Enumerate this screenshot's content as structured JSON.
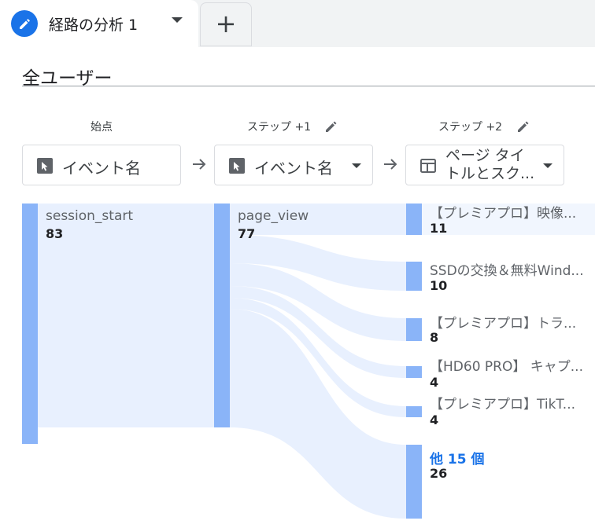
{
  "tab": {
    "title": "経路の分析 1",
    "add_label": "+"
  },
  "segment": {
    "title": "全ユーザー"
  },
  "columns": {
    "start": {
      "label": "始点",
      "dimension": "イベント名"
    },
    "step1": {
      "label": "ステップ +1",
      "dimension": "イベント名"
    },
    "step2": {
      "label": "ステップ +2",
      "dimension_line1": "ページ タイ",
      "dimension_line2": "トルとスク..."
    }
  },
  "nodes": {
    "start": {
      "label": "session_start",
      "value": "83"
    },
    "step1": {
      "label": "page_view",
      "value": "77"
    },
    "step2": [
      {
        "label": "【プレミアプロ】映像...",
        "value": "11"
      },
      {
        "label": "SSDの交換＆無料Wind...",
        "value": "10"
      },
      {
        "label": "【プレミアプロ】トラ...",
        "value": "8"
      },
      {
        "label": "【HD60 PRO】 キャプ...",
        "value": "4"
      },
      {
        "label": "【プレミアプロ】TikT...",
        "value": "4"
      }
    ],
    "more": {
      "label": "他 15 個",
      "value": "26"
    }
  },
  "colors": {
    "accent": "#1a73e8",
    "node_bar": "#8ab4f8",
    "flow": "#e8f0fe"
  },
  "icons": {
    "tab": "pencil-icon",
    "event": "cursor-click-icon",
    "page": "page-title-icon"
  }
}
